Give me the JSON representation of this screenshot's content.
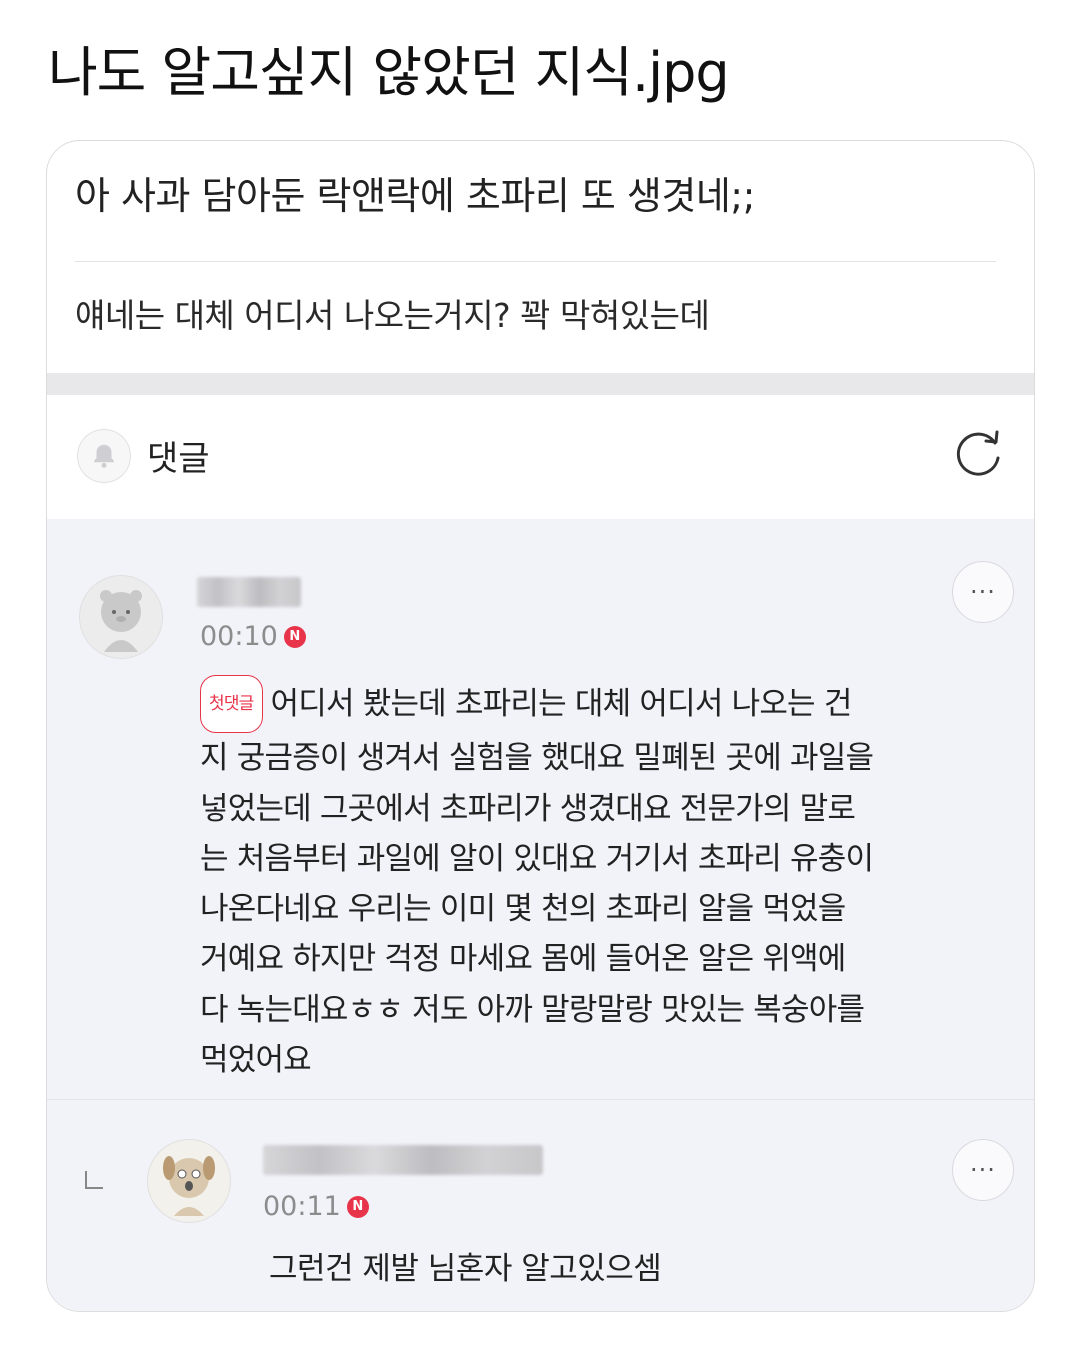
{
  "page_heading": "나도 알고싶지 않았던 지식.jpg",
  "post": {
    "title": "아 사과 담아둔 락앤락에 초파리 또 생겻네;;",
    "body": "얘네는 대체 어디서 나오는거지? 꽉 막혀있는데"
  },
  "comments_section": {
    "label": "댓글",
    "bell_icon": "bell-icon",
    "refresh_icon": "refresh-icon"
  },
  "comments": [
    {
      "time": "00:10",
      "n_badge": "N",
      "first_badge": "첫댓글",
      "text": "어디서 봤는데 초파리는 대체 어디서 나오는 건\n지 궁금증이 생겨서 실험을 했대요 밀폐된 곳에 과일을\n넣었는데 그곳에서 초파리가 생겼대요 전문가의 말로\n는 처음부터 과일에 알이 있대요 거기서 초파리 유충이\n나온다네요 우리는 이미 몇 천의 초파리 알을 먹었을\n거예요 하지만 걱정 마세요 몸에 들어온 알은 위액에\n다 녹는대요ㅎㅎ 저도 아까 말랑말랑 맛있는 복숭아를\n먹었어요",
      "more_label": "···"
    },
    {
      "time": "00:11",
      "n_badge": "N",
      "reply_mark": "ㄴ",
      "text": "그런건 제발 님혼자 알고있으셈",
      "more_label": "···"
    }
  ],
  "colors": {
    "accent_red": "#e8344a",
    "comments_background": "#f2f3f9"
  }
}
